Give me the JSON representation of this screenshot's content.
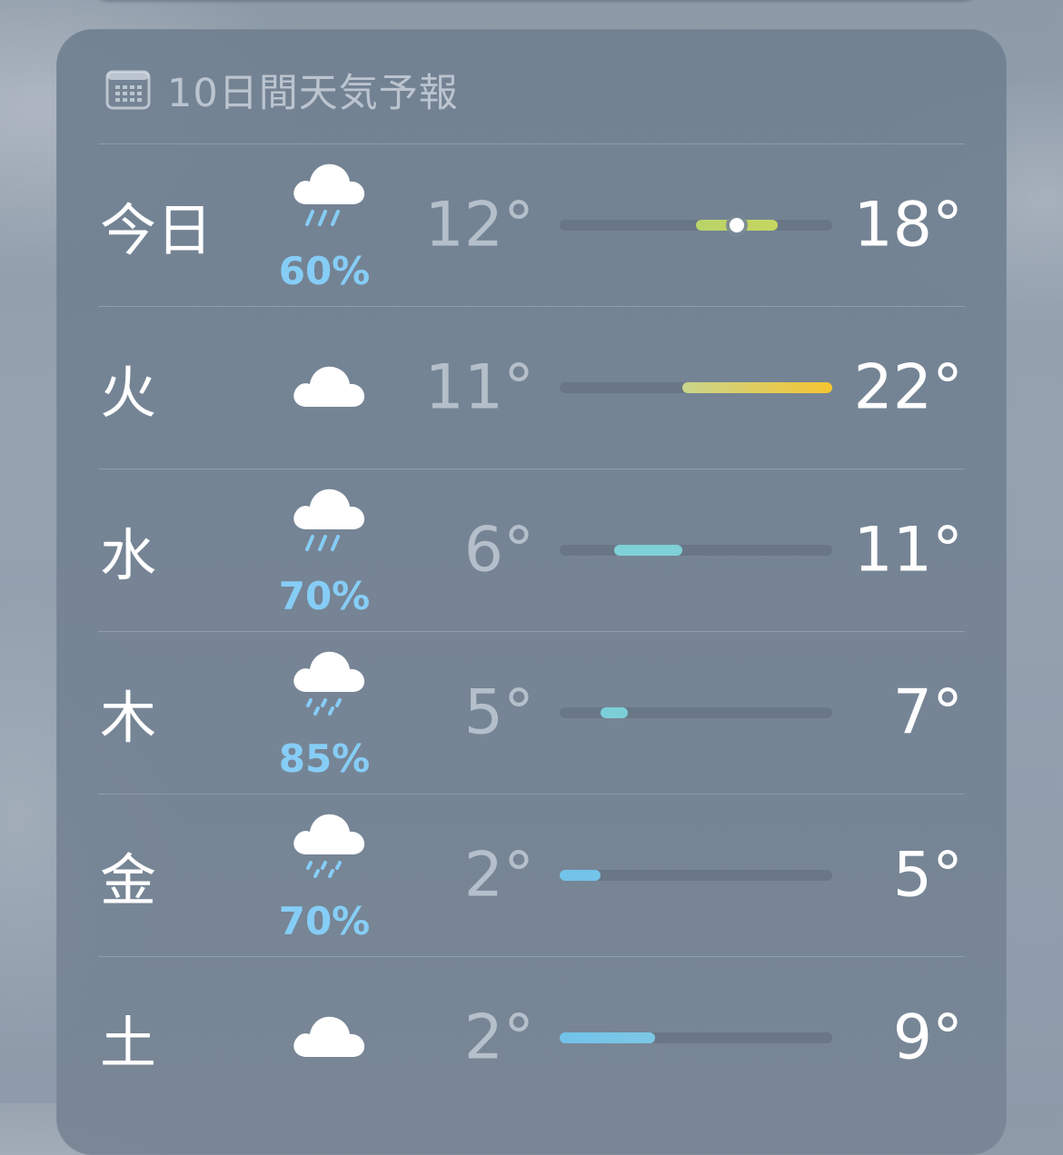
{
  "header": {
    "title": "10日間天気予報",
    "icon": "calendar-icon"
  },
  "range": {
    "min": 2,
    "max": 22
  },
  "days": [
    {
      "label": "今日",
      "icon": "cloud-rain-icon",
      "precip": "60%",
      "low": "12°",
      "high": "18°",
      "lowValue": 12,
      "highValue": 18,
      "current": 15,
      "colors": [
        "#b9d36a",
        "#c6d660"
      ]
    },
    {
      "label": "火",
      "icon": "cloud-icon",
      "precip": "",
      "low": "11°",
      "high": "22°",
      "lowValue": 11,
      "highValue": 22,
      "colors": [
        "#c9d58c",
        "#f6c531"
      ]
    },
    {
      "label": "水",
      "icon": "cloud-rain-icon",
      "precip": "70%",
      "low": "6°",
      "high": "11°",
      "lowValue": 6,
      "highValue": 11,
      "colors": [
        "#7ed1d6",
        "#7ed1d6"
      ]
    },
    {
      "label": "木",
      "icon": "cloud-drizzle-icon",
      "precip": "85%",
      "low": "5°",
      "high": "7°",
      "lowValue": 5,
      "highValue": 7,
      "colors": [
        "#7ccfd9",
        "#7ccfd9"
      ]
    },
    {
      "label": "金",
      "icon": "cloud-drizzle-icon",
      "precip": "70%",
      "low": "2°",
      "high": "5°",
      "lowValue": 2,
      "highValue": 5,
      "colors": [
        "#73c4ea",
        "#73c4ea"
      ]
    },
    {
      "label": "土",
      "icon": "cloud-icon",
      "precip": "",
      "low": "2°",
      "high": "9°",
      "lowValue": 2,
      "highValue": 9,
      "colors": [
        "#72c2ea",
        "#7cc8e6"
      ]
    }
  ]
}
